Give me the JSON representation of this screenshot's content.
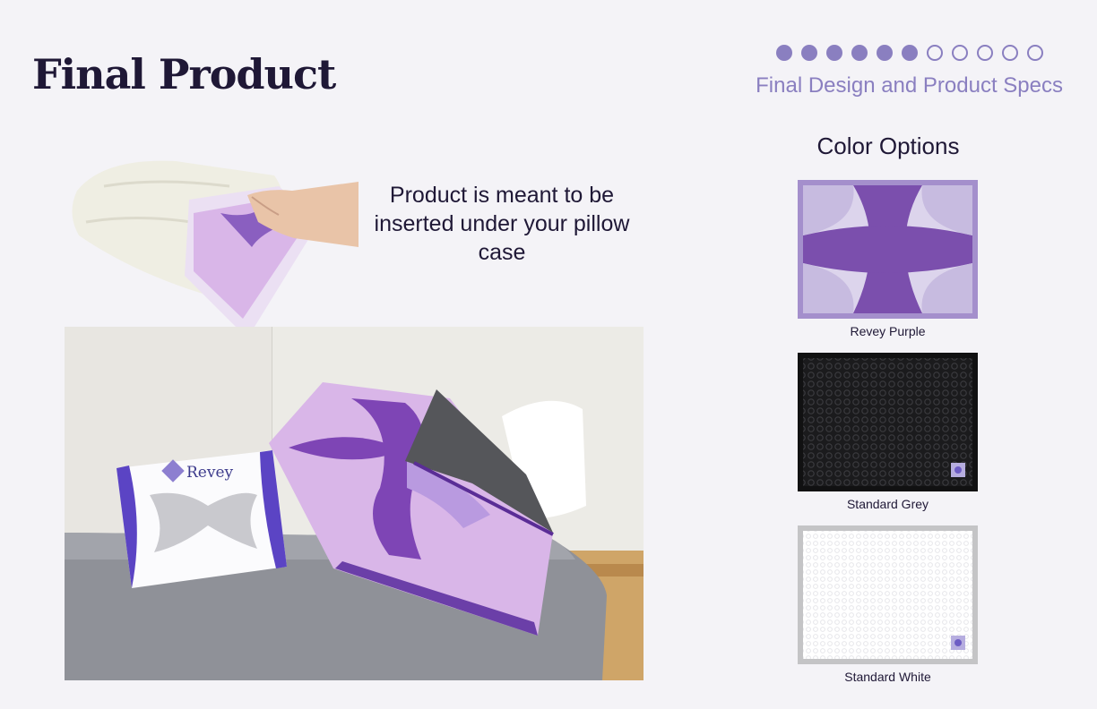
{
  "slide": {
    "title": "Final Product",
    "subtitle": "Final Design and Product Specs",
    "progress": {
      "filled": 6,
      "total": 11
    }
  },
  "caption": "Product is meant to be inserted under your pillow case",
  "box_brand": "Revey",
  "color_options": {
    "title": "Color Options",
    "items": [
      {
        "label": "Revey Purple",
        "base": "#a48fcc",
        "accent": "#7b4fad"
      },
      {
        "label": "Standard Grey",
        "base": "#1b1b1d",
        "accent": "#3a3a3e"
      },
      {
        "label": "Standard White",
        "base": "#ffffff",
        "accent": "#e6e6ea"
      }
    ]
  },
  "colors": {
    "accent": "#8a7fc0",
    "text": "#1f1836",
    "background": "#f4f3f7"
  }
}
